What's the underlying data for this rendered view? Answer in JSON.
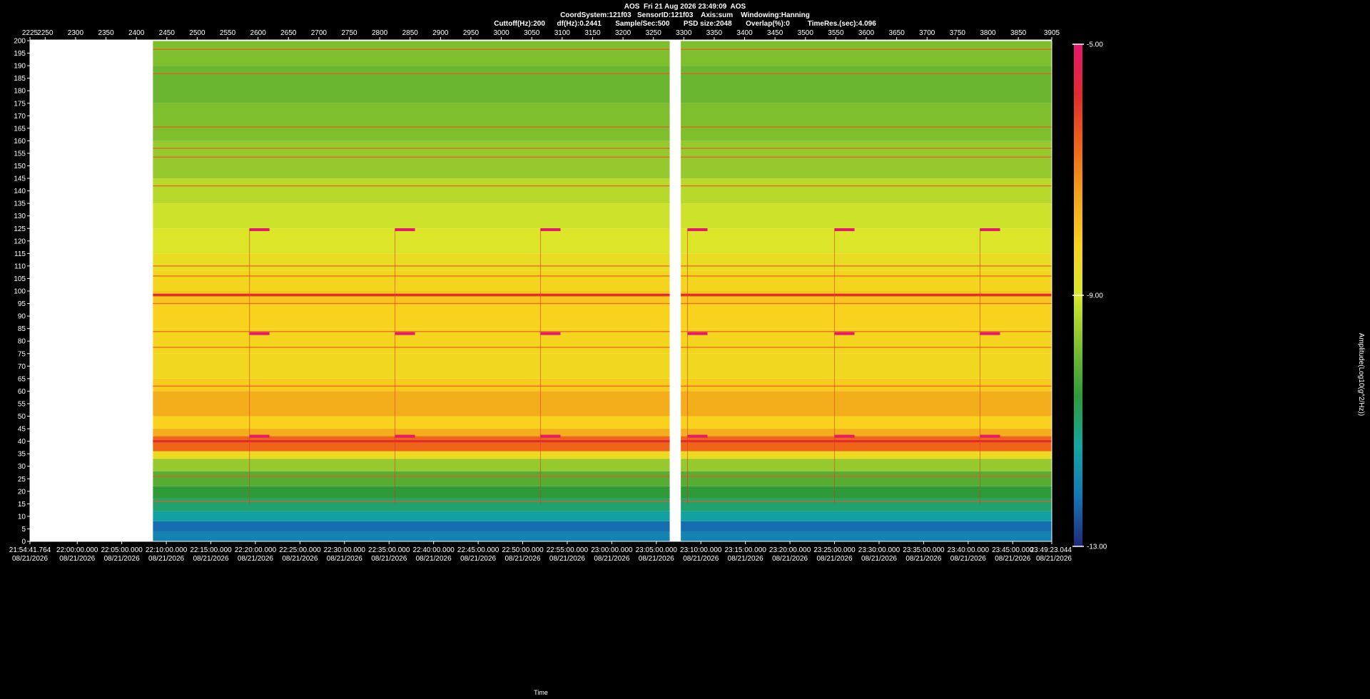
{
  "header": {
    "line1": "AOS  Fri 21 Aug 2026 23:49:09  AOS",
    "line2": "CoordSystem:121f03   SensorID:121f03    Axis:sum    Windowing:Hanning",
    "line3": "Cuttoff(Hz):200      df(Hz):0.2441       Sample/Sec:500       PSD size:2048       Overlap(%):0         TimeRes.(sec):4.096"
  },
  "chart_data": {
    "type": "heatmap",
    "title": "",
    "xlabel": "Time",
    "ylabel": "",
    "colorbar_label": "Amplitude(Log10(g^2/Hz))",
    "ylim": [
      0,
      200
    ],
    "clim": [
      -13.0,
      -5.0
    ],
    "colorbar_ticks": [
      "-5.00",
      "-9.00",
      "-13.00"
    ],
    "y_ticks": [
      0,
      5,
      10,
      15,
      20,
      25,
      30,
      35,
      40,
      45,
      50,
      55,
      60,
      65,
      70,
      75,
      80,
      85,
      90,
      95,
      100,
      105,
      110,
      115,
      120,
      125,
      130,
      135,
      140,
      145,
      150,
      155,
      160,
      165,
      170,
      175,
      180,
      185,
      190,
      195,
      200
    ],
    "top_axis_ticks": [
      "2225",
      "2250",
      "2300",
      "2350",
      "2400",
      "2450",
      "2500",
      "2550",
      "2600",
      "2650",
      "2700",
      "2750",
      "2800",
      "2850",
      "2900",
      "2950",
      "3000",
      "3050",
      "3100",
      "3150",
      "3200",
      "3250",
      "3300",
      "3350",
      "3400",
      "3450",
      "3500",
      "3550",
      "3600",
      "3650",
      "3700",
      "3750",
      "3800",
      "3850",
      "3905"
    ],
    "top_axis_range": [
      2225,
      3905
    ],
    "time_ticks": [
      {
        "time": "21:54:41.764",
        "date": "08/21/2026"
      },
      {
        "time": "22:00:00.000",
        "date": "08/21/2026"
      },
      {
        "time": "22:05:00.000",
        "date": "08/21/2026"
      },
      {
        "time": "22:10:00.000",
        "date": "08/21/2026"
      },
      {
        "time": "22:15:00.000",
        "date": "08/21/2026"
      },
      {
        "time": "22:20:00.000",
        "date": "08/21/2026"
      },
      {
        "time": "22:25:00.000",
        "date": "08/21/2026"
      },
      {
        "time": "22:30:00.000",
        "date": "08/21/2026"
      },
      {
        "time": "22:35:00.000",
        "date": "08/21/2026"
      },
      {
        "time": "22:40:00.000",
        "date": "08/21/2026"
      },
      {
        "time": "22:45:00.000",
        "date": "08/21/2026"
      },
      {
        "time": "22:50:00.000",
        "date": "08/21/2026"
      },
      {
        "time": "22:55:00.000",
        "date": "08/21/2026"
      },
      {
        "time": "23:00:00.000",
        "date": "08/21/2026"
      },
      {
        "time": "23:05:00.000",
        "date": "08/21/2026"
      },
      {
        "time": "23:10:00.000",
        "date": "08/21/2026"
      },
      {
        "time": "23:15:00.000",
        "date": "08/21/2026"
      },
      {
        "time": "23:20:00.000",
        "date": "08/21/2026"
      },
      {
        "time": "23:25:00.000",
        "date": "08/21/2026"
      },
      {
        "time": "23:30:00.000",
        "date": "08/21/2026"
      },
      {
        "time": "23:35:00.000",
        "date": "08/21/2026"
      },
      {
        "time": "23:40:00.000",
        "date": "08/21/2026"
      },
      {
        "time": "23:45:00.000",
        "date": "08/21/2026"
      },
      {
        "time": "23:49:23.044",
        "date": "08/21/2026"
      }
    ],
    "data_segments": [
      {
        "start": "22:08:30",
        "end": "23:06:30"
      },
      {
        "start": "23:07:45",
        "end": "23:49:23.044"
      }
    ],
    "frequency_bands": [
      {
        "f0": 0,
        "f1": 4,
        "level": -12.0
      },
      {
        "f0": 4,
        "f1": 8,
        "level": -12.3
      },
      {
        "f0": 8,
        "f1": 12,
        "level": -11.5
      },
      {
        "f0": 12,
        "f1": 17,
        "level": -11.0
      },
      {
        "f0": 17,
        "f1": 22,
        "level": -10.6
      },
      {
        "f0": 22,
        "f1": 28,
        "level": -10.2
      },
      {
        "f0": 28,
        "f1": 33,
        "level": -9.6
      },
      {
        "f0": 33,
        "f1": 36,
        "level": -8.5
      },
      {
        "f0": 36,
        "f1": 42,
        "level": -6.6
      },
      {
        "f0": 42,
        "f1": 45,
        "level": -7.6
      },
      {
        "f0": 45,
        "f1": 50,
        "level": -8.2
      },
      {
        "f0": 50,
        "f1": 60,
        "level": -7.6
      },
      {
        "f0": 60,
        "f1": 65,
        "level": -8.1
      },
      {
        "f0": 65,
        "f1": 75,
        "level": -8.4
      },
      {
        "f0": 75,
        "f1": 85,
        "level": -8.3
      },
      {
        "f0": 85,
        "f1": 95,
        "level": -8.2
      },
      {
        "f0": 95,
        "f1": 100,
        "level": -8.0
      },
      {
        "f0": 100,
        "f1": 108,
        "level": -8.3
      },
      {
        "f0": 108,
        "f1": 115,
        "level": -8.6
      },
      {
        "f0": 115,
        "f1": 125,
        "level": -8.9
      },
      {
        "f0": 125,
        "f1": 135,
        "level": -9.1
      },
      {
        "f0": 135,
        "f1": 145,
        "level": -9.3
      },
      {
        "f0": 145,
        "f1": 160,
        "level": -9.6
      },
      {
        "f0": 160,
        "f1": 175,
        "level": -9.8
      },
      {
        "f0": 175,
        "f1": 190,
        "level": -10.0
      },
      {
        "f0": 190,
        "f1": 200,
        "level": -9.8
      }
    ],
    "tonal_lines_hz": [
      196.5,
      186.8,
      165.5,
      157,
      153.5,
      142,
      110,
      106,
      98,
      95,
      83.8,
      77.5,
      62,
      26,
      16
    ],
    "strong_tonal_lines_hz": [
      98.5,
      40
    ],
    "periodic_events": [
      {
        "time": "22:19:20",
        "tones_hz": [
          124.5,
          83,
          42
        ]
      },
      {
        "time": "22:35:40",
        "tones_hz": [
          124.5,
          83,
          42
        ]
      },
      {
        "time": "22:52:00",
        "tones_hz": [
          124.5,
          83,
          42
        ]
      },
      {
        "time": "23:08:30",
        "tones_hz": [
          124.5,
          83,
          42
        ]
      },
      {
        "time": "23:25:00",
        "tones_hz": [
          124.5,
          83,
          42
        ]
      },
      {
        "time": "23:41:20",
        "tones_hz": [
          124.5,
          83,
          42
        ]
      }
    ],
    "colormap": [
      "#1f2a7a",
      "#1477b8",
      "#12a7a0",
      "#2f9a3a",
      "#7fbf2e",
      "#d8e82a",
      "#f8d21c",
      "#f4a21a",
      "#ee6418",
      "#e02a2e",
      "#e6186e"
    ],
    "colorbar_positions": [
      0,
      0.1,
      0.2,
      0.3,
      0.4,
      0.5,
      0.6,
      0.7,
      0.8,
      0.9,
      1.0
    ],
    "background_color": "#000000",
    "nodata_color": "#ffffff"
  }
}
